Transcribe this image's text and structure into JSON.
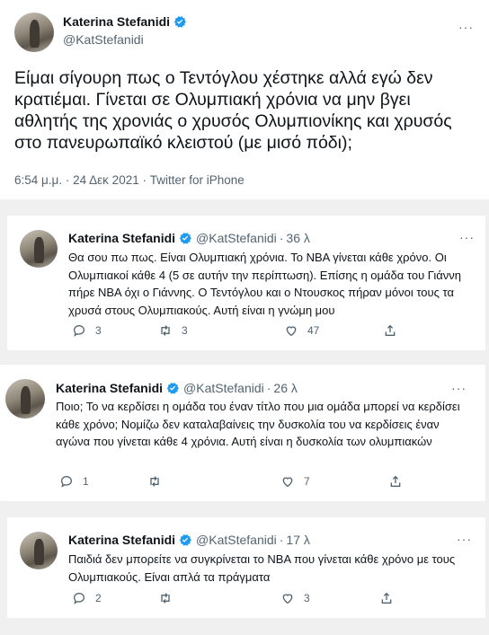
{
  "main_tweet": {
    "name": "Katerina Stefanidi",
    "handle": "@KatStefanidi",
    "text": "Είμαι σίγουρη πως ο Τεντόγλου χέστηκε αλλά εγώ δεν κρατιέμαι. Γίνεται σε Ολυμπιακή χρόνια να μην βγει αθλητής της χρονιάς ο χρυσός Ολυμπιονίκης και χρυσός στο πανευρωπαϊκό κλειστού (με μισό πόδι);",
    "time": "6:54 μ.μ.",
    "date": "24 Δεκ 2021",
    "source": "Twitter for iPhone",
    "meta_sep": "·",
    "more": "···"
  },
  "replies": [
    {
      "name": "Katerina Stefanidi",
      "handle": "@KatStefanidi",
      "sep": "·",
      "time": "36 λ",
      "more": "···",
      "text": "Θα σου πω πως. Είναι Ολυμπιακή χρόνια. Το NBA γίνεται κάθε χρόνο. Οι Ολυμπιακοί κάθε 4 (5 σε αυτήν την περίπτωση). Επίσης η ομάδα του Γιάννη πήρε NBA όχι ο Γιάννης. Ο Τεντόγλου και ο Ντουσκος πήραν μόνοι τους τα χρυσά στους Ολυμπιακούς. Αυτή είναι η γνώμη μου",
      "reply_count": "3",
      "retweet_count": "3",
      "like_count": "47"
    },
    {
      "name": "Katerina Stefanidi",
      "handle": "@KatStefanidi",
      "sep": "·",
      "time": "26 λ",
      "more": "···",
      "text": "Ποιο; Το να κερδίσει η ομάδα του έναν τίτλο που μια ομάδα μπορεί να κερδίσει κάθε χρόνο; Νομίζω δεν καταλαβαίνεις την δυσκολία του να κερδίσεις έναν αγώνα που γίνεται κάθε 4 χρόνια. Αυτή είναι η δυσκολία των ολυμπιακών",
      "reply_count": "1",
      "retweet_count": "",
      "like_count": "7"
    },
    {
      "name": "Katerina Stefanidi",
      "handle": "@KatStefanidi",
      "sep": "·",
      "time": "17 λ",
      "more": "···",
      "text": "Παιδιά δεν μπορείτε να συγκρίνεται το NBA που γίνεται κάθε χρόνο με τους Ολυμπιακούς. Είναι απλά τα πράγματα",
      "reply_count": "2",
      "retweet_count": "",
      "like_count": "3"
    }
  ],
  "icons": {
    "verified": "verified-badge-icon",
    "reply": "reply-icon",
    "retweet": "retweet-icon",
    "like": "like-icon",
    "share": "share-icon"
  },
  "colors": {
    "verified_blue": "#1d9bf0",
    "secondary_text": "#536471",
    "primary_text": "#0f1419",
    "background": "#f0f0f0"
  }
}
